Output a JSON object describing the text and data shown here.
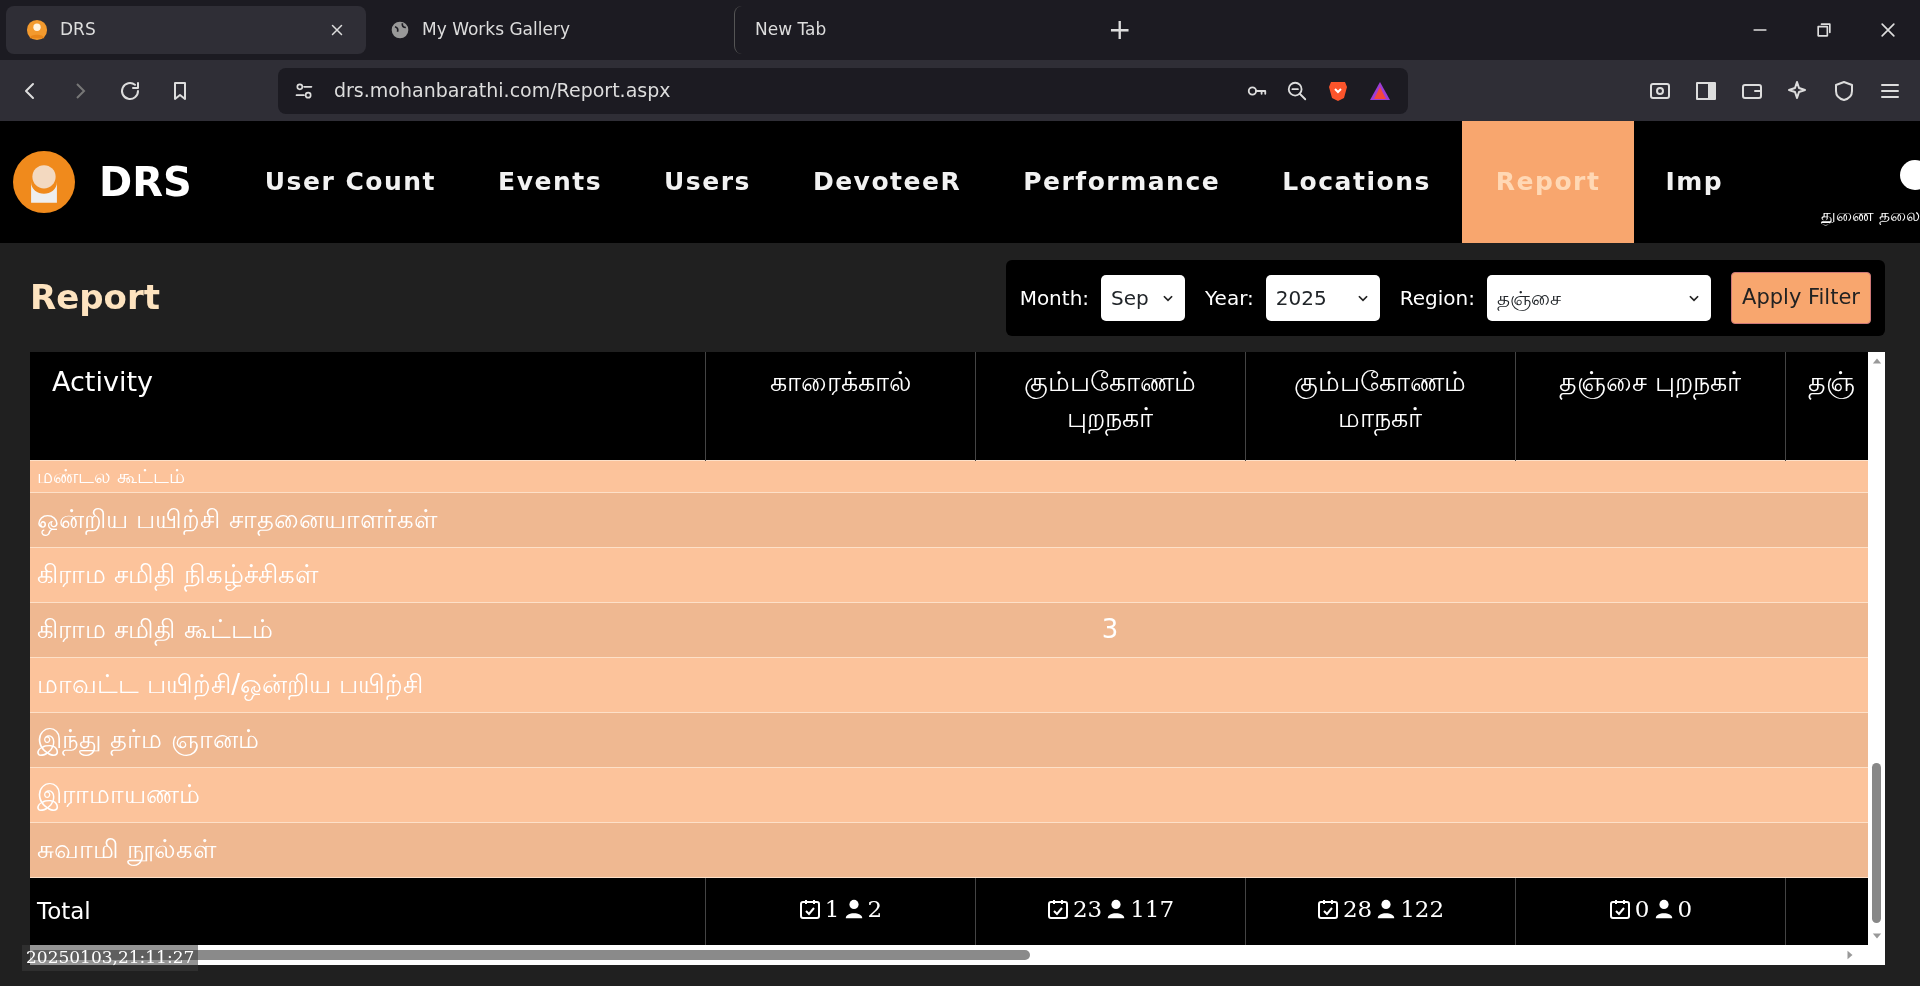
{
  "browser": {
    "tabs": [
      {
        "title": "DRS",
        "selected": true,
        "kind": "site"
      },
      {
        "title": "My Works Gallery",
        "selected": false,
        "kind": "web"
      },
      {
        "title": "New Tab",
        "selected": false,
        "kind": "blank"
      }
    ],
    "new_tab": "+",
    "url": "drs.mohanbarathi.com/Report.aspx"
  },
  "navbar": {
    "brand": "DRS",
    "items": [
      {
        "label": "User Count",
        "selected": false
      },
      {
        "label": "Events",
        "selected": false
      },
      {
        "label": "Users",
        "selected": false
      },
      {
        "label": "DevoteeR",
        "selected": false
      },
      {
        "label": "Performance",
        "selected": false
      },
      {
        "label": "Locations",
        "selected": false
      },
      {
        "label": "Report",
        "selected": true
      },
      {
        "label": "Imp",
        "selected": false
      }
    ],
    "user_role": "துணை தலை"
  },
  "page_title": "Report",
  "filters": [
    {
      "label": "Month:",
      "value": "Sep",
      "kind": "select"
    },
    {
      "label": "Year:",
      "value": "2025",
      "kind": "select"
    },
    {
      "label": "Region:",
      "value": "தஞ்சை",
      "kind": "select"
    }
  ],
  "apply_button": "Apply Filter",
  "table": {
    "columns": [
      "Activity",
      "காரைக்கால்",
      "கும்பகோணம் புறநகர்",
      "கும்பகோணம் மாநகர்",
      "தஞ்சை புறநகர்",
      "தஞ்"
    ],
    "rows": [
      {
        "cells": [
          "மண்டல கூட்டம்",
          "",
          "",
          "",
          "",
          ""
        ]
      },
      {
        "cells": [
          "ஒன்றிய பயிற்சி சாதனையாளர்கள்",
          "",
          "",
          "",
          "",
          ""
        ]
      },
      {
        "cells": [
          "கிராம சமிதி நிகழ்ச்சிகள்",
          "",
          "",
          "",
          "",
          ""
        ]
      },
      {
        "cells": [
          "கிராம சமிதி கூட்டம்",
          "",
          "3",
          "",
          "",
          ""
        ]
      },
      {
        "cells": [
          "மாவட்ட பயிற்சி/ஒன்றிய பயிற்சி",
          "",
          "",
          "",
          "",
          ""
        ]
      },
      {
        "cells": [
          "இந்து தர்ம ஞானம்",
          "",
          "",
          "",
          "",
          ""
        ]
      },
      {
        "cells": [
          "இராமாயணம்",
          "",
          "",
          "",
          "",
          ""
        ]
      },
      {
        "cells": [
          "சுவாமி நூல்கள்",
          "",
          "",
          "",
          "",
          ""
        ]
      }
    ],
    "total": {
      "label": "Total",
      "cells": [
        {
          "events": "1",
          "people": "2"
        },
        {
          "events": "23",
          "people": "117"
        },
        {
          "events": "28",
          "people": "122"
        },
        {
          "events": "0",
          "people": "0"
        },
        {}
      ]
    }
  },
  "timestamp_overlay": "20250103,21:11:27"
}
